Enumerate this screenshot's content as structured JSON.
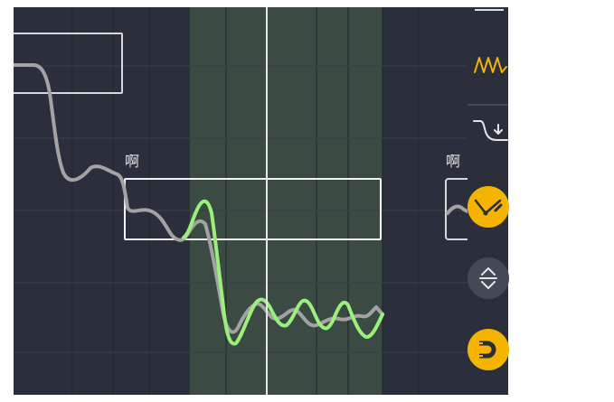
{
  "editor": {
    "lyrics": [
      {
        "text": "啊"
      },
      {
        "text": "啊"
      }
    ]
  },
  "toolbar": {
    "tools": [
      {
        "icon": "line-icon",
        "state": "inactive"
      },
      {
        "icon": "vibrato-wave-icon",
        "state": "inactive",
        "color": "#f5b400"
      },
      {
        "icon": "pitch-bend-down-icon",
        "state": "inactive"
      },
      {
        "icon": "pitch-curve-edit-icon",
        "state": "active",
        "color": "#f5b400"
      },
      {
        "icon": "up-down-arrows-icon",
        "state": "inactive"
      },
      {
        "icon": "magnet-snap-icon",
        "state": "active",
        "color": "#f5b400"
      }
    ]
  },
  "colors": {
    "background": "#2b2f3b",
    "selection_region": "#3b4a42",
    "original_pitch_curve": "#a3a3a3",
    "edited_pitch_curve": "#9af07a",
    "playhead": "#e0e0e0",
    "accent": "#f5b400"
  }
}
